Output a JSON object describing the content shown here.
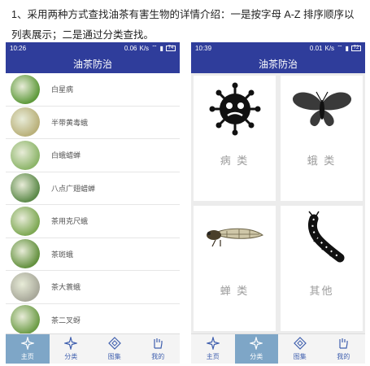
{
  "doc": {
    "intro": "1、采用两种方式查找油茶有害生物的详情介绍：一是按字母 A-Z 排序顺序以列表展示；二是通过分类查找。"
  },
  "left_screen": {
    "status": {
      "time": "10:26",
      "speed": "0.06",
      "unit": "K/s",
      "battery": "74"
    },
    "title": "油茶防治",
    "items": [
      {
        "label": "白星病",
        "color": "#5f9a3c"
      },
      {
        "label": "半带黄毒蛾",
        "color": "#b9b07a"
      },
      {
        "label": "白蛾蜡蝉",
        "color": "#8db56a"
      },
      {
        "label": "八点广翅蜡蝉",
        "color": "#5d8a4a"
      },
      {
        "label": "茶用克尺蛾",
        "color": "#7ea854"
      },
      {
        "label": "茶斑蛾",
        "color": "#64913f"
      },
      {
        "label": "茶大蓑蛾",
        "color": "#a8a89a"
      },
      {
        "label": "茶二叉蚜",
        "color": "#6d9c47"
      }
    ],
    "tabs": [
      {
        "label": "主页",
        "active": true
      },
      {
        "label": "分类",
        "active": false
      },
      {
        "label": "图集",
        "active": false
      },
      {
        "label": "我的",
        "active": false
      }
    ]
  },
  "right_screen": {
    "status": {
      "time": "10:39",
      "speed": "0.01",
      "unit": "K/s",
      "battery": "72"
    },
    "title": "油茶防治",
    "categories": [
      {
        "label": "病 类",
        "icon": "virus-icon"
      },
      {
        "label": "蛾 类",
        "icon": "moth-icon"
      },
      {
        "label": "蝉 类",
        "icon": "cicada-icon"
      },
      {
        "label": "其他",
        "icon": "caterpillar-icon"
      }
    ],
    "tabs": [
      {
        "label": "主页",
        "active": false
      },
      {
        "label": "分类",
        "active": true
      },
      {
        "label": "图集",
        "active": false
      },
      {
        "label": "我的",
        "active": false
      }
    ]
  }
}
